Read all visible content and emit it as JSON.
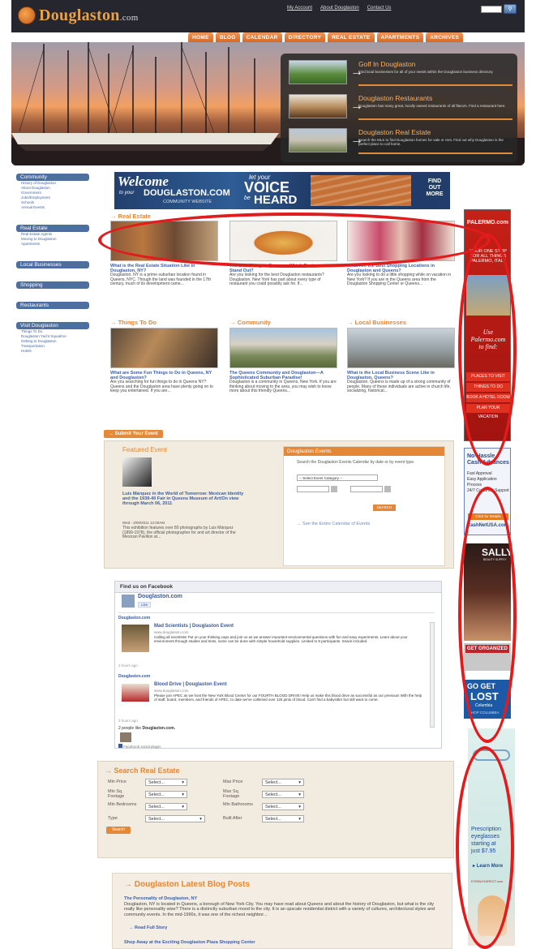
{
  "header": {
    "logo": "Douglaston",
    "logo_suffix": ".com",
    "links": [
      "My Account",
      "About Douglaston",
      "Contact Us"
    ],
    "search_placeholder": ""
  },
  "nav": [
    "HOME",
    "BLOG",
    "CALENDAR",
    "DIRECTORY",
    "REAL ESTATE",
    "APARTMENTS",
    "ARCHIVES"
  ],
  "hero_panel": [
    {
      "title": "Golf In Douglaston",
      "desc": "Find local businesses for all of your needs within the Douglaston business directory."
    },
    {
      "title": "Douglaston Restaurants",
      "desc": "Douglaston has many great, locally owned restaurants of all flavors. Find a restaurant here."
    },
    {
      "title": "Douglaston Real Estate",
      "desc": "Search the MLS to find Douglaston homes for sale or rent. Find out why Douglaston is the perfect place to call home."
    }
  ],
  "sidebar": {
    "community": {
      "head": "Community",
      "items": [
        "History of Douglaston",
        "About Douglaston",
        "Government",
        "Jobs/Employment",
        "Schools",
        "Annual Events"
      ]
    },
    "realestate": {
      "head": "Real Estate",
      "items": [
        "Real Estate Agents",
        "Moving to Douglaston",
        "Apartments"
      ]
    },
    "local": {
      "head": "Local Businesses"
    },
    "shopping": {
      "head": "Shopping"
    },
    "restaurants": {
      "head": "Restaurants"
    },
    "visit": {
      "head": "Visit Douglaston",
      "items": [
        "Things To Do",
        "Douglaston Yacht Squadron",
        "Getting to Douglaston",
        "Transportation",
        "Hotels"
      ]
    }
  },
  "banner": {
    "welcome": "Welcome",
    "to_your": "to your",
    "site": "DOUGLASTON.COM",
    "community": "COMMUNITY WEBSITE",
    "let_your": "let your",
    "voice": "VOICE",
    "be": "be",
    "heard": "HEARD",
    "find_out": "FIND OUT MORE"
  },
  "realestate_section": {
    "head": "Real Estate",
    "stories": [
      {
        "title": "What is the Real Estate Situation Like in Douglaston, NY?",
        "desc": "Douglaston, NY is a prime suburban location found in Queens, NYC. Though the land was founded in the 17th century, much of its development came..."
      },
      {
        "title": "The Best Thing to Queens—Which Restaurants Stand Out?",
        "desc": "Are you looking for the best Douglaston restaurants? Douglaston, New York has part about every type of restaurant you could possibly ask for. If..."
      },
      {
        "title": "What Are the Best Shopping Locations in Douglaston and Queens?",
        "desc": "Are you looking to do a little shopping while on vacation in New York? If you are in the Queens area from the Douglaston Shopping Center or Queens..."
      }
    ]
  },
  "middle_sections": [
    {
      "head": "Things To Do",
      "title": "What are Some Fun Things to Do in Queens, NY and Douglaston?",
      "desc": "Are you searching for fun things to do in Queens NY? Queens and the Douglaston area have plenty going on to keep you entertained. If you are..."
    },
    {
      "head": "Community",
      "title": "The Queens Community and Douglaston—A Sophisticated Suburban Paradise!",
      "desc": "Douglaston is a community in Queens, New York. If you are thinking about moving to the area, you may wish to know more about this friendly Queens..."
    },
    {
      "head": "Local Businesses",
      "title": "What is the Local Business Scene Like in Douglaston, Queens?",
      "desc": "Douglaston, Queens is made up of a strong community of people. Many of these individuals are active in church life, socializing, historical..."
    }
  ],
  "right_ad": {
    "brand": "PALERMO.com",
    "tag": "YOUR ONE STOP FOR ALL THINGS PALERMO, ITALY",
    "use": "Use Palermo.com to find:",
    "items": [
      "PLACES TO VISIT",
      "THINGS TO DO",
      "BOOK A HOTEL ROOM",
      "PLAN YOUR VACATION"
    ]
  },
  "right_ad2": {
    "title": "No-Hassle Cash Advances",
    "items": [
      "Fast Approval",
      "Easy Application Process",
      "24/7 Customer Support"
    ],
    "cta": "Click for Details",
    "site": "CashNetUSA.com"
  },
  "right_ad3": {
    "brand": "SALLY",
    "sub": "BEAUTY SUPPLY"
  },
  "right_ad4": {
    "text": "GET ORGANIZED"
  },
  "right_ad5": {
    "line1": "GO GET",
    "line2": "LOST",
    "brand": "Columbia",
    "cta": "SHOP COLUMBIA"
  },
  "right_ad6": {
    "t1": "Prescription",
    "t2": "eyeglasses",
    "t3": "starting at",
    "t4": "just $7.95",
    "cta": "Learn More",
    "brand": "EYEBUYDIRECT.com"
  },
  "submit_event": "Submit Your Event",
  "featured": {
    "head": "Featured Event",
    "title": "Luis Márquez in the World of Tomorrow: Mexican Identity and the 1939-40 Fair in Queens Museum of Art/On view through March 06, 2011",
    "when": "Wed - 3/09/2011 12:00AM",
    "desc": "This exhibition features over 80 photographs by Luis Márquez (1899-1978), the official photographer for and art director of the Mexican Pavilion at..."
  },
  "events": {
    "head": "Douglaston Events",
    "desc": "Search the Douglaston Events Calendar by date or by event type.",
    "category": "-- Select Event Category --",
    "search": "SEARCH",
    "see_all": "See the Entire Calendar of Events"
  },
  "facebook": {
    "head": "Find us on Facebook",
    "page": "Douglaston.com",
    "like": "Like",
    "posts": [
      {
        "source": "Douglaston.com",
        "title": "Mad Scientists | Douglaston Event",
        "url": "www.douglaston.com",
        "desc": "Calling all scientists! Put on your thinking caps and join us as we answer important environmental questions with fun and easy experiments. Learn about your environment through studies and tests, some can be done with simple household supplies. Limited to 8 participants. Snack included.",
        "time": "3 hours ago"
      },
      {
        "source": "Douglaston.com",
        "title": "Blood Drive | Douglaston Event",
        "url": "www.douglaston.com",
        "desc": "Please join APEC as we host the New York Blood Center for our FOURTH BLOOD DRIVE! Help us make this blood drive as successful as our previous! With the help of staff, board, members, and friends of APEC, to date we've collected over 125 pints of blood. Can't find a babysitter but still want to come.",
        "time": "3 hours ago"
      }
    ],
    "people": "2 people like",
    "people_page": "Douglaston.com.",
    "plugin": "Facebook social plugin"
  },
  "search_re": {
    "head": "Search Real Estate",
    "fields_left": [
      "Min Price",
      "Min Sq. Footage",
      "Min Bedrooms",
      "Type"
    ],
    "fields_right": [
      "Max Price",
      "Max Sq. Footage",
      "Min Bathrooms",
      "Built After"
    ],
    "select": "Select...",
    "button": "Search"
  },
  "blog": {
    "head": "Douglaston Latest Blog Posts",
    "post_title": "The Personality of Douglaston, NY",
    "post_desc": "Douglaston, NY is located in Queens, a borough of New York City. You may have read about Queens and about the history of Douglaston, but what is the city really like personality wise? There is a distinctly suburban mood to the city. It is an upscale residential district with a variety of cultures, architectural styles and community events. In the mid-1990s, it was one of the richest neighbor...",
    "read_more": "Read Full Story",
    "next_title": "Shop Away at the Exciting Douglaston Plaza Shopping Center"
  }
}
